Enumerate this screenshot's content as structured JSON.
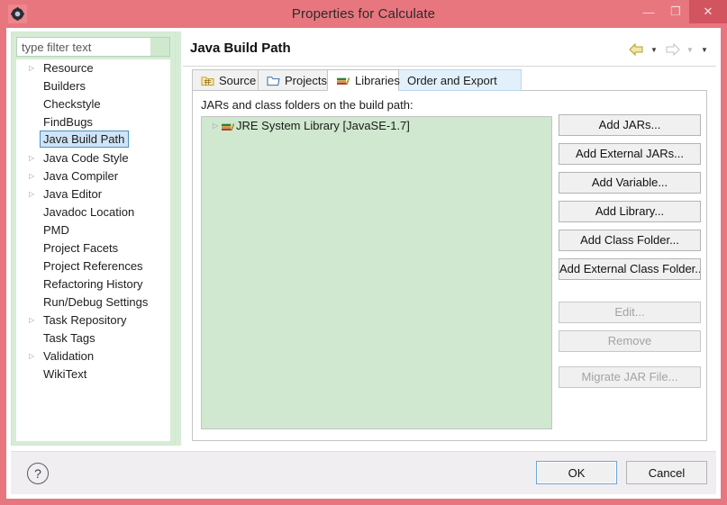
{
  "window": {
    "title": "Properties for Calculate",
    "icon": "gear-icon",
    "minimize_label": "—",
    "maximize_label": "❐",
    "close_label": "✕",
    "titlebar_color": "#e8767f",
    "close_color": "#d2545f"
  },
  "sidebar": {
    "filter": {
      "value": "",
      "placeholder": "type filter text"
    },
    "items": [
      {
        "label": "Resource",
        "expandable": true,
        "selected": false
      },
      {
        "label": "Builders",
        "expandable": false,
        "selected": false
      },
      {
        "label": "Checkstyle",
        "expandable": false,
        "selected": false
      },
      {
        "label": "FindBugs",
        "expandable": false,
        "selected": false
      },
      {
        "label": "Java Build Path",
        "expandable": false,
        "selected": true
      },
      {
        "label": "Java Code Style",
        "expandable": true,
        "selected": false
      },
      {
        "label": "Java Compiler",
        "expandable": true,
        "selected": false
      },
      {
        "label": "Java Editor",
        "expandable": true,
        "selected": false
      },
      {
        "label": "Javadoc Location",
        "expandable": false,
        "selected": false
      },
      {
        "label": "PMD",
        "expandable": false,
        "selected": false
      },
      {
        "label": "Project Facets",
        "expandable": false,
        "selected": false
      },
      {
        "label": "Project References",
        "expandable": false,
        "selected": false
      },
      {
        "label": "Refactoring History",
        "expandable": false,
        "selected": false
      },
      {
        "label": "Run/Debug Settings",
        "expandable": false,
        "selected": false
      },
      {
        "label": "Task Repository",
        "expandable": true,
        "selected": false
      },
      {
        "label": "Task Tags",
        "expandable": false,
        "selected": false
      },
      {
        "label": "Validation",
        "expandable": true,
        "selected": false
      },
      {
        "label": "WikiText",
        "expandable": false,
        "selected": false
      }
    ]
  },
  "page": {
    "title": "Java Build Path",
    "nav": {
      "back_icon": "back-arrow-icon",
      "back_caret_icon": "chevron-down-icon",
      "forward_icon": "forward-arrow-icon",
      "forward_caret_icon": "chevron-down-icon",
      "menu_caret_icon": "chevron-down-icon"
    },
    "tabs": [
      {
        "label": "Source",
        "icon": "source-folder-icon",
        "state": "normal"
      },
      {
        "label": "Projects",
        "icon": "projects-folder-icon",
        "state": "normal"
      },
      {
        "label": "Libraries",
        "icon": "libraries-icon",
        "state": "active"
      },
      {
        "label": "Order and Export",
        "icon": "",
        "state": "hover"
      }
    ],
    "content": {
      "label": "JARs and class folders on the build path:",
      "list_background": "#cfe8cf",
      "entries": [
        {
          "label": "JRE System Library [JavaSE-1.7]",
          "icon": "library-books-icon",
          "expandable": true
        }
      ],
      "buttons": [
        {
          "label": "Add JARs...",
          "enabled": true,
          "group": 1
        },
        {
          "label": "Add External JARs...",
          "enabled": true,
          "group": 1
        },
        {
          "label": "Add Variable...",
          "enabled": true,
          "group": 1
        },
        {
          "label": "Add Library...",
          "enabled": true,
          "group": 1
        },
        {
          "label": "Add Class Folder...",
          "enabled": true,
          "group": 1
        },
        {
          "label": "Add External Class Folder...",
          "enabled": true,
          "group": 1
        },
        {
          "label": "Edit...",
          "enabled": false,
          "group": 2
        },
        {
          "label": "Remove",
          "enabled": false,
          "group": 2
        },
        {
          "label": "Migrate JAR File...",
          "enabled": false,
          "group": 3
        }
      ]
    }
  },
  "footer": {
    "help_icon": "question-mark-icon",
    "ok_label": "OK",
    "cancel_label": "Cancel"
  }
}
